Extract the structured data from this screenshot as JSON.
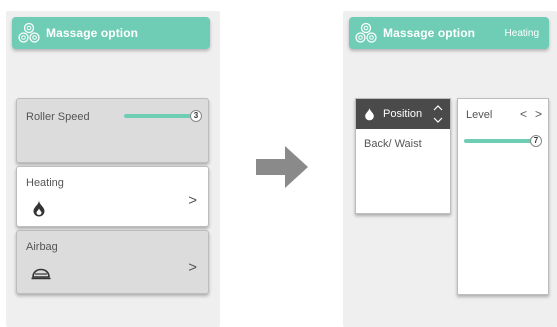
{
  "left_panel": {
    "header": {
      "title": "Massage option",
      "icon": "massage-rollers-icon"
    },
    "roller_card": {
      "label": "Roller Speed",
      "value": 3,
      "max": 3
    },
    "heating_card": {
      "label": "Heating",
      "icon": "flame-icon",
      "chevron": ">"
    },
    "airbag_card": {
      "label": "Airbag",
      "icon": "airbag-icon",
      "chevron": ">"
    }
  },
  "transition_arrow": {
    "icon": "arrow-right-icon"
  },
  "right_panel": {
    "header": {
      "title": "Massage option",
      "status": "Heating",
      "icon": "massage-rollers-icon"
    },
    "position": {
      "label": "Position",
      "icon": "flame-icon",
      "value": "Back/ Waist"
    },
    "level": {
      "label": "Level",
      "prev": "<",
      "next": ">",
      "value": 7,
      "max": 7
    }
  },
  "colors": {
    "accent": "#6fcdb5",
    "panel": "#efefef",
    "dark": "#4a4a4a",
    "card_gray": "#dcdcdc"
  }
}
